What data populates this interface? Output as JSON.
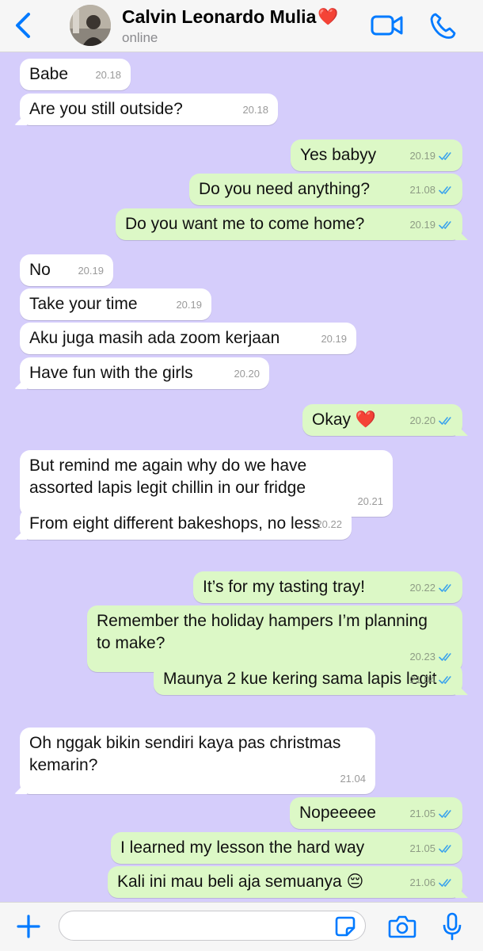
{
  "header": {
    "contact_name": "Calvin Leonardo Mulia",
    "contact_status": "online",
    "heart": "❤️",
    "accent": "#007aff"
  },
  "chat": {
    "background": "#d5cdfb",
    "messages": [
      {
        "dir": "in",
        "lines": [
          "Babe"
        ],
        "time": "20.18"
      },
      {
        "dir": "in",
        "lines": [
          "Are you still outside?"
        ],
        "time": "20.18"
      },
      {
        "dir": "out",
        "lines": [
          "Yes babyy"
        ],
        "time": "20.19"
      },
      {
        "dir": "out",
        "lines": [
          "Do you need anything?"
        ],
        "time": "21.08"
      },
      {
        "dir": "out",
        "lines": [
          "Do you want me to come home?"
        ],
        "time": "20.19"
      },
      {
        "dir": "in",
        "lines": [
          "No"
        ],
        "time": "20.19"
      },
      {
        "dir": "in",
        "lines": [
          "Take your time"
        ],
        "time": "20.19"
      },
      {
        "dir": "in",
        "lines": [
          "Aku juga masih ada zoom kerjaan"
        ],
        "time": "20.19"
      },
      {
        "dir": "in",
        "lines": [
          "Have fun with the girls"
        ],
        "time": "20.20"
      },
      {
        "dir": "out",
        "lines": [
          "Okay ❤️"
        ],
        "time": "20.20"
      },
      {
        "dir": "in",
        "lines": [
          "But remind me again why do we have",
          "assorted lapis legit chillin in our fridge"
        ],
        "time": "20.21"
      },
      {
        "dir": "in",
        "lines": [
          "From eight different bakeshops, no less"
        ],
        "time": "20.22"
      },
      {
        "dir": "out",
        "lines": [
          "It’s for my tasting tray!"
        ],
        "time": "20.22"
      },
      {
        "dir": "out",
        "lines": [
          "Remember the holiday hampers I’m planning",
          "to make?"
        ],
        "time": "20.23"
      },
      {
        "dir": "out",
        "lines": [
          "Maunya 2 kue kering sama lapis legit"
        ],
        "time": "21.04"
      },
      {
        "dir": "in",
        "lines": [
          "Oh nggak bikin sendiri kaya pas christmas",
          "kemarin?"
        ],
        "time": "21.04"
      },
      {
        "dir": "out",
        "lines": [
          "Nopeeeee"
        ],
        "time": "21.05"
      },
      {
        "dir": "out",
        "lines": [
          "I learned my lesson the hard way"
        ],
        "time": "21.05"
      },
      {
        "dir": "out",
        "lines": [
          "Kali ini mau beli aja semuanya 😔"
        ],
        "time": "21.06"
      }
    ]
  },
  "composer": {
    "value": "",
    "icons": [
      "plus-icon",
      "sticker-icon",
      "camera-icon",
      "microphone-icon"
    ]
  }
}
